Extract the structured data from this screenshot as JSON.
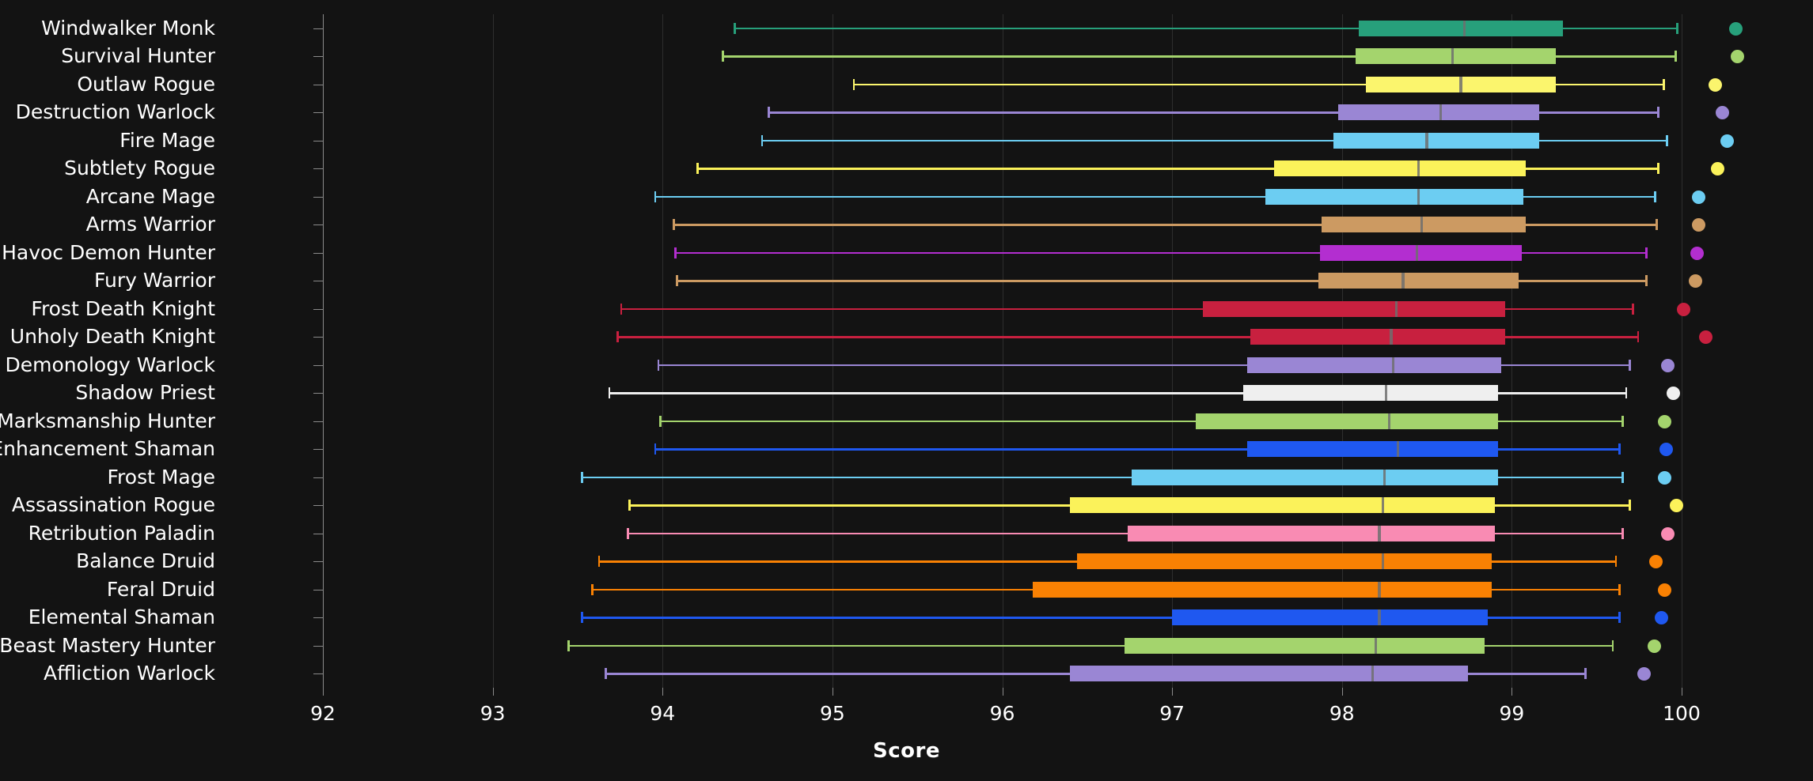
{
  "chart": {
    "type": "box",
    "title": "",
    "xlabel": "Score",
    "ylabel": "",
    "background": "#131313",
    "grid": true,
    "legend": "none",
    "xlim": [
      92,
      100
    ],
    "xticks": [
      92,
      93,
      94,
      95,
      96,
      97,
      98,
      99,
      100
    ],
    "xticklabels": [
      "92",
      "93",
      "94",
      "95",
      "96",
      "97",
      "98",
      "99",
      "100"
    ]
  },
  "chart_data": {
    "type": "box",
    "title": "",
    "xlabel": "Score",
    "ylabel": "",
    "xlim": [
      92,
      100
    ],
    "xticks": [
      92,
      93,
      94,
      95,
      96,
      97,
      98,
      99,
      100
    ],
    "grid": true,
    "legend": "none",
    "orientation": "horizontal",
    "categories": [
      "Windwalker Monk",
      "Survival Hunter",
      "Outlaw Rogue",
      "Destruction Warlock",
      "Fire Mage",
      "Subtlety Rogue",
      "Arcane Mage",
      "Arms Warrior",
      "Havoc Demon Hunter",
      "Fury Warrior",
      "Frost Death Knight",
      "Unholy Death Knight",
      "Demonology Warlock",
      "Shadow Priest",
      "Marksmanship Hunter",
      "Enhancement Shaman",
      "Frost Mage",
      "Assassination Rogue",
      "Retribution Paladin",
      "Balance Druid",
      "Feral Druid",
      "Elemental Shaman",
      "Beast Mastery Hunter",
      "Affliction Warlock"
    ],
    "boxes": [
      {
        "label": "Windwalker Monk",
        "whisker_low": 94.42,
        "q1": 98.1,
        "median": 98.72,
        "q3": 99.3,
        "whisker_high": 99.98,
        "flier": 100.32,
        "color": "#27a07b"
      },
      {
        "label": "Survival Hunter",
        "whisker_low": 94.35,
        "q1": 98.08,
        "median": 98.65,
        "q3": 99.26,
        "whisker_high": 99.97,
        "flier": 100.33,
        "color": "#a4d46d"
      },
      {
        "label": "Outlaw Rogue",
        "whisker_low": 95.12,
        "q1": 98.14,
        "median": 98.7,
        "q3": 99.26,
        "whisker_high": 99.9,
        "flier": 100.2,
        "color": "#fbf56d"
      },
      {
        "label": "Destruction Warlock",
        "whisker_low": 94.62,
        "q1": 97.98,
        "median": 98.58,
        "q3": 99.16,
        "whisker_high": 99.87,
        "flier": 100.24,
        "color": "#9a86d4"
      },
      {
        "label": "Fire Mage",
        "whisker_low": 94.58,
        "q1": 97.95,
        "median": 98.5,
        "q3": 99.16,
        "whisker_high": 99.92,
        "flier": 100.27,
        "color": "#6ccdf2"
      },
      {
        "label": "Subtlety Rogue",
        "whisker_low": 94.2,
        "q1": 97.6,
        "median": 98.45,
        "q3": 99.08,
        "whisker_high": 99.87,
        "flier": 100.21,
        "color": "#fbf25a"
      },
      {
        "label": "Arcane Mage",
        "whisker_low": 93.95,
        "q1": 97.55,
        "median": 98.45,
        "q3": 99.07,
        "whisker_high": 99.85,
        "flier": 100.1,
        "color": "#6ccdf2"
      },
      {
        "label": "Arms Warrior",
        "whisker_low": 94.06,
        "q1": 97.88,
        "median": 98.47,
        "q3": 99.08,
        "whisker_high": 99.86,
        "flier": 100.1,
        "color": "#cc9a62"
      },
      {
        "label": "Havoc Demon Hunter",
        "whisker_low": 94.07,
        "q1": 97.87,
        "median": 98.44,
        "q3": 99.06,
        "whisker_high": 99.8,
        "flier": 100.09,
        "color": "#b32ed0"
      },
      {
        "label": "Fury Warrior",
        "whisker_low": 94.08,
        "q1": 97.86,
        "median": 98.36,
        "q3": 99.04,
        "whisker_high": 99.8,
        "flier": 100.08,
        "color": "#cc9a62"
      },
      {
        "label": "Frost Death Knight",
        "whisker_low": 93.75,
        "q1": 97.18,
        "median": 98.32,
        "q3": 98.96,
        "whisker_high": 99.72,
        "flier": 100.01,
        "color": "#c8203f"
      },
      {
        "label": "Unholy Death Knight",
        "whisker_low": 93.73,
        "q1": 97.46,
        "median": 98.29,
        "q3": 98.96,
        "whisker_high": 99.75,
        "flier": 100.14,
        "color": "#c8203f"
      },
      {
        "label": "Demonology Warlock",
        "whisker_low": 93.97,
        "q1": 97.44,
        "median": 98.3,
        "q3": 98.94,
        "whisker_high": 99.7,
        "flier": 99.92,
        "color": "#9a86d4"
      },
      {
        "label": "Shadow Priest",
        "whisker_low": 93.68,
        "q1": 97.42,
        "median": 98.26,
        "q3": 98.92,
        "whisker_high": 99.68,
        "flier": 99.95,
        "color": "#efefef"
      },
      {
        "label": "Marksmanship Hunter",
        "whisker_low": 93.98,
        "q1": 97.14,
        "median": 98.28,
        "q3": 98.92,
        "whisker_high": 99.66,
        "flier": 99.9,
        "color": "#a4d46d"
      },
      {
        "label": "Enhancement Shaman",
        "whisker_low": 93.95,
        "q1": 97.44,
        "median": 98.33,
        "q3": 98.92,
        "whisker_high": 99.64,
        "flier": 99.91,
        "color": "#1f58f0"
      },
      {
        "label": "Frost Mage",
        "whisker_low": 93.52,
        "q1": 96.76,
        "median": 98.25,
        "q3": 98.92,
        "whisker_high": 99.66,
        "flier": 99.9,
        "color": "#6ccdf2"
      },
      {
        "label": "Assassination Rogue",
        "whisker_low": 93.8,
        "q1": 96.4,
        "median": 98.24,
        "q3": 98.9,
        "whisker_high": 99.7,
        "flier": 99.97,
        "color": "#fbf25a"
      },
      {
        "label": "Retribution Paladin",
        "whisker_low": 93.79,
        "q1": 96.74,
        "median": 98.22,
        "q3": 98.9,
        "whisker_high": 99.66,
        "flier": 99.92,
        "color": "#f98bb3"
      },
      {
        "label": "Balance Druid",
        "whisker_low": 93.62,
        "q1": 96.44,
        "median": 98.24,
        "q3": 98.88,
        "whisker_high": 99.62,
        "flier": 99.85,
        "color": "#f98103"
      },
      {
        "label": "Feral Druid",
        "whisker_low": 93.58,
        "q1": 96.18,
        "median": 98.22,
        "q3": 98.88,
        "whisker_high": 99.64,
        "flier": 99.9,
        "color": "#f98103"
      },
      {
        "label": "Elemental Shaman",
        "whisker_low": 93.52,
        "q1": 97.0,
        "median": 98.22,
        "q3": 98.86,
        "whisker_high": 99.64,
        "flier": 99.88,
        "color": "#1f58f0"
      },
      {
        "label": "Beast Mastery Hunter",
        "whisker_low": 93.44,
        "q1": 96.72,
        "median": 98.2,
        "q3": 98.84,
        "whisker_high": 99.6,
        "flier": 99.84,
        "color": "#a4d46d"
      },
      {
        "label": "Affliction Warlock",
        "whisker_low": 93.66,
        "q1": 96.4,
        "median": 98.18,
        "q3": 98.74,
        "whisker_high": 99.44,
        "flier": 99.78,
        "color": "#9a86d4"
      }
    ]
  }
}
